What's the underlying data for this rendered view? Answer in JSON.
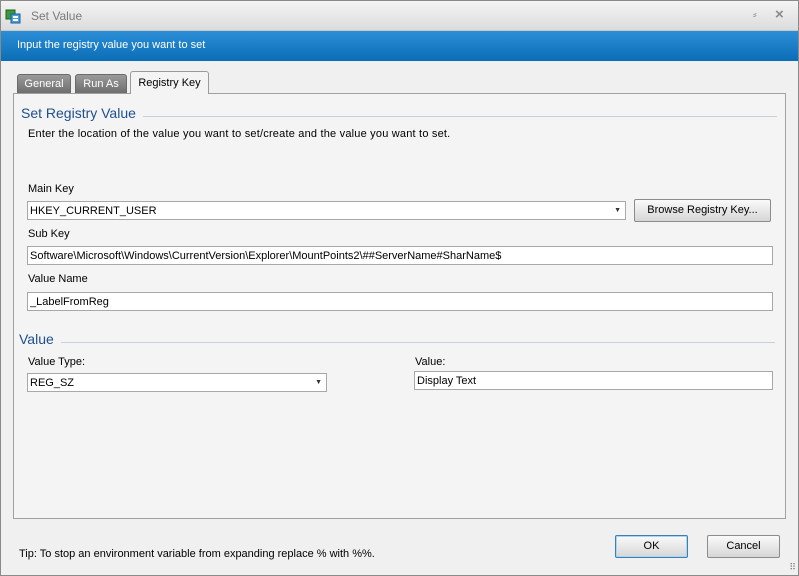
{
  "window": {
    "title": "Set Value",
    "pin_glyph": "⸗",
    "close_glyph": "×"
  },
  "banner": {
    "text": "Input the registry value you want to set"
  },
  "tabs": [
    {
      "label": "General"
    },
    {
      "label": "Run As"
    },
    {
      "label": "Registry Key"
    }
  ],
  "set_registry_value": {
    "heading": "Set Registry Value",
    "instruction": "Enter the location of the value you want to set/create and the value you want to set.",
    "main_key": {
      "label": "Main Key",
      "value": "HKEY_CURRENT_USER"
    },
    "browse_button": "Browse Registry Key...",
    "sub_key": {
      "label": "Sub Key",
      "value": "Software\\Microsoft\\Windows\\CurrentVersion\\Explorer\\MountPoints2\\##ServerName#SharName$"
    },
    "value_name": {
      "label": "Value Name",
      "value": "_LabelFromReg"
    }
  },
  "value_section": {
    "heading": "Value",
    "value_type": {
      "label": "Value Type:",
      "value": "REG_SZ"
    },
    "value": {
      "label": "Value:",
      "value": "Display Text"
    }
  },
  "footer": {
    "tip": "Tip: To stop an environment variable from expanding replace % with %%.",
    "ok_label": "OK",
    "cancel_label": "Cancel"
  },
  "icons": {
    "app": "registry-app-icon",
    "dropdown": "chevron-down-icon",
    "grip": "resize-grip-icon"
  }
}
